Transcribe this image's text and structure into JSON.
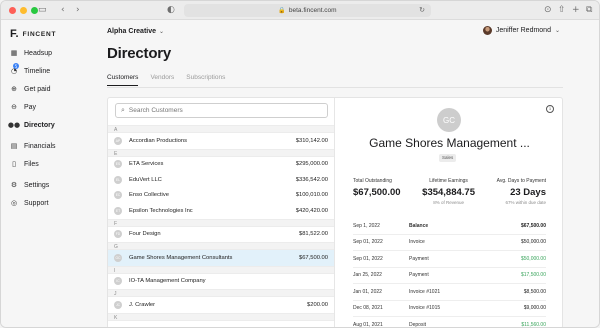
{
  "browser": {
    "url": "beta.fincent.com"
  },
  "app": {
    "logo_mark": "F.",
    "logo_text": "FINCENT"
  },
  "sidebar": {
    "items": [
      {
        "label": "Headsup",
        "icon": "grid-icon"
      },
      {
        "label": "Timeline",
        "icon": "timeline-icon",
        "badge": "5"
      },
      {
        "label": "Get paid",
        "icon": "get-paid-icon"
      },
      {
        "label": "Pay",
        "icon": "pay-icon"
      },
      {
        "label": "Directory",
        "icon": "people-icon",
        "active": true
      },
      {
        "label": "Financials",
        "icon": "financials-icon"
      },
      {
        "label": "Files",
        "icon": "file-icon"
      },
      {
        "label": "Settings",
        "icon": "gear-icon"
      },
      {
        "label": "Support",
        "icon": "support-icon"
      }
    ]
  },
  "header": {
    "company": "Alpha Creative",
    "user_name": "Jeniffer Redmond",
    "page_title": "Directory",
    "tabs": [
      "Customers",
      "Vendors",
      "Subscriptions"
    ]
  },
  "search": {
    "placeholder": "Search Customers"
  },
  "customers": {
    "groups": [
      {
        "letter": "A",
        "rows": [
          {
            "initials": "AP",
            "name": "Accordian Productions",
            "amount": "$310,142.00"
          }
        ]
      },
      {
        "letter": "E",
        "rows": [
          {
            "initials": "ES",
            "name": "ETA Services",
            "amount": "$295,000.00"
          },
          {
            "initials": "EL",
            "name": "EduVert LLC",
            "amount": "$336,542.00"
          },
          {
            "initials": "EC",
            "name": "Enso Collective",
            "amount": "$100,010.00"
          },
          {
            "initials": "ET",
            "name": "Epsilon Technologies Inc",
            "amount": "$420,420.00"
          }
        ]
      },
      {
        "letter": "F",
        "rows": [
          {
            "initials": "FD",
            "name": "Four Design",
            "amount": "$81,522.00"
          }
        ]
      },
      {
        "letter": "G",
        "rows": [
          {
            "initials": "GC",
            "name": "Game Shores Management Consultants",
            "amount": "$67,500.00",
            "selected": true
          }
        ]
      },
      {
        "letter": "I",
        "rows": [
          {
            "initials": "IC",
            "name": "IO-TA Management Company",
            "amount": ""
          }
        ]
      },
      {
        "letter": "J",
        "rows": [
          {
            "initials": "JC",
            "name": "J. Crawler",
            "amount": "$200.00"
          }
        ]
      },
      {
        "letter": "K",
        "rows": []
      }
    ]
  },
  "detail": {
    "initials": "GC",
    "name": "Game Shores Management ...",
    "tag": "Sales",
    "stats": [
      {
        "label": "Total Outstanding",
        "value": "$67,500.00",
        "sub": ""
      },
      {
        "label": "Lifetime Earnings",
        "value": "$354,884.75",
        "sub": "8% of Revenue"
      },
      {
        "label": "Avg. Days to Payment",
        "value": "23 Days",
        "sub": "67% within due date"
      }
    ],
    "ledger": [
      {
        "date": "Sep 1, 2022",
        "type": "Balance",
        "amount": "$67,500.00",
        "head": true
      },
      {
        "date": "Sep 01, 2022",
        "type": "Invoice",
        "amount": "$50,000.00"
      },
      {
        "date": "Sep 01, 2022",
        "type": "Payment",
        "amount": "$50,000.00",
        "positive": true
      },
      {
        "date": "Jan 25, 2022",
        "type": "Payment",
        "amount": "$17,500.00",
        "positive": true
      },
      {
        "date": "Jan 01, 2022",
        "type": "Invoice #1021",
        "amount": "$8,500.00"
      },
      {
        "date": "Dec 08, 2021",
        "type": "Invoice #1015",
        "amount": "$9,000.00"
      },
      {
        "date": "Aug 01, 2021",
        "type": "Deposit",
        "amount": "$11,560.00",
        "positive": true
      }
    ]
  },
  "colors": {
    "accent": "#3b82f6",
    "selected_row": "#e2f1fa",
    "positive": "#3aa55c"
  }
}
